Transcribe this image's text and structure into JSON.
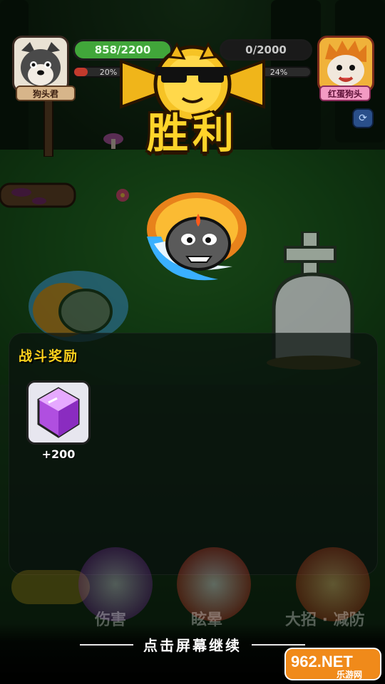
{
  "player": {
    "name": "狗头君",
    "hp_text": "858/2200",
    "rage_text": "20%",
    "rage_fraction": 0.2
  },
  "enemy": {
    "name": "红蛋狗头",
    "hp_text": "0/2000",
    "rage_text": "24%",
    "rage_fraction": 0.24
  },
  "victory_title": "胜利",
  "rewards": {
    "title": "战斗奖励",
    "items": [
      {
        "icon": "purple-gem-icon",
        "amount": "+200"
      }
    ]
  },
  "skills": [
    {
      "label": "伤害"
    },
    {
      "label": "眩晕"
    },
    {
      "label": "大招 · 减防"
    }
  ],
  "continue_text": "点击屏幕继续",
  "watermark": {
    "main": "962.NET",
    "sub": "乐游网"
  },
  "colors": {
    "gold": "#ffd42a",
    "hp_green": "#41a63a",
    "rage_red": "#c23a2c",
    "gem_purple": "#b04fe0"
  }
}
